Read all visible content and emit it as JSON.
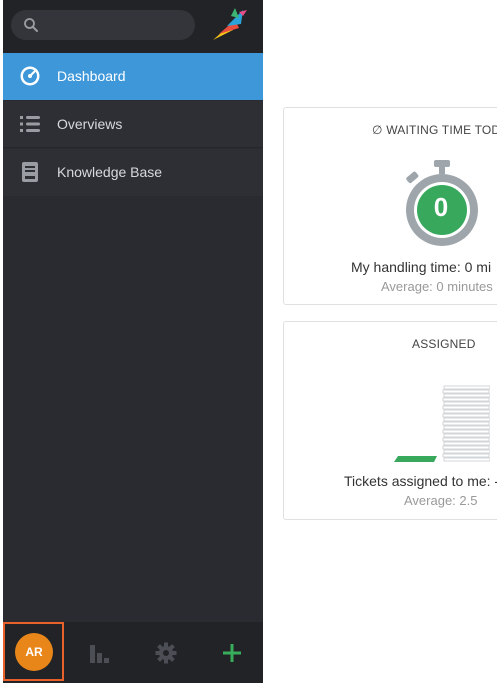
{
  "search": {
    "placeholder": ""
  },
  "sidebar": {
    "items": [
      {
        "label": "Dashboard",
        "icon": "dashboard-gauge-icon",
        "active": true
      },
      {
        "label": "Overviews",
        "icon": "list-icon",
        "active": false
      },
      {
        "label": "Knowledge Base",
        "icon": "book-icon",
        "active": false
      }
    ]
  },
  "user": {
    "initials": "AR"
  },
  "bottom_bar": {
    "icons": [
      "stats-icon",
      "gear-icon",
      "plus-icon"
    ]
  },
  "cards": {
    "waiting": {
      "icon": "∅",
      "title": "WAITING TIME TODA",
      "value": "0",
      "handling": "My handling time: 0 mi",
      "average": "Average: 0 minutes"
    },
    "assigned": {
      "title": "ASSIGNED",
      "assigned_text": "Tickets assigned to me: -",
      "average": "Average: 2.5"
    }
  },
  "colors": {
    "sidebar_bg": "#2a2b30",
    "active_nav": "#3e97d9",
    "avatar": "#e8861a",
    "avatar_highlight": "#e8602a",
    "success_green": "#38a85c",
    "plus_green": "#38ae5c"
  }
}
